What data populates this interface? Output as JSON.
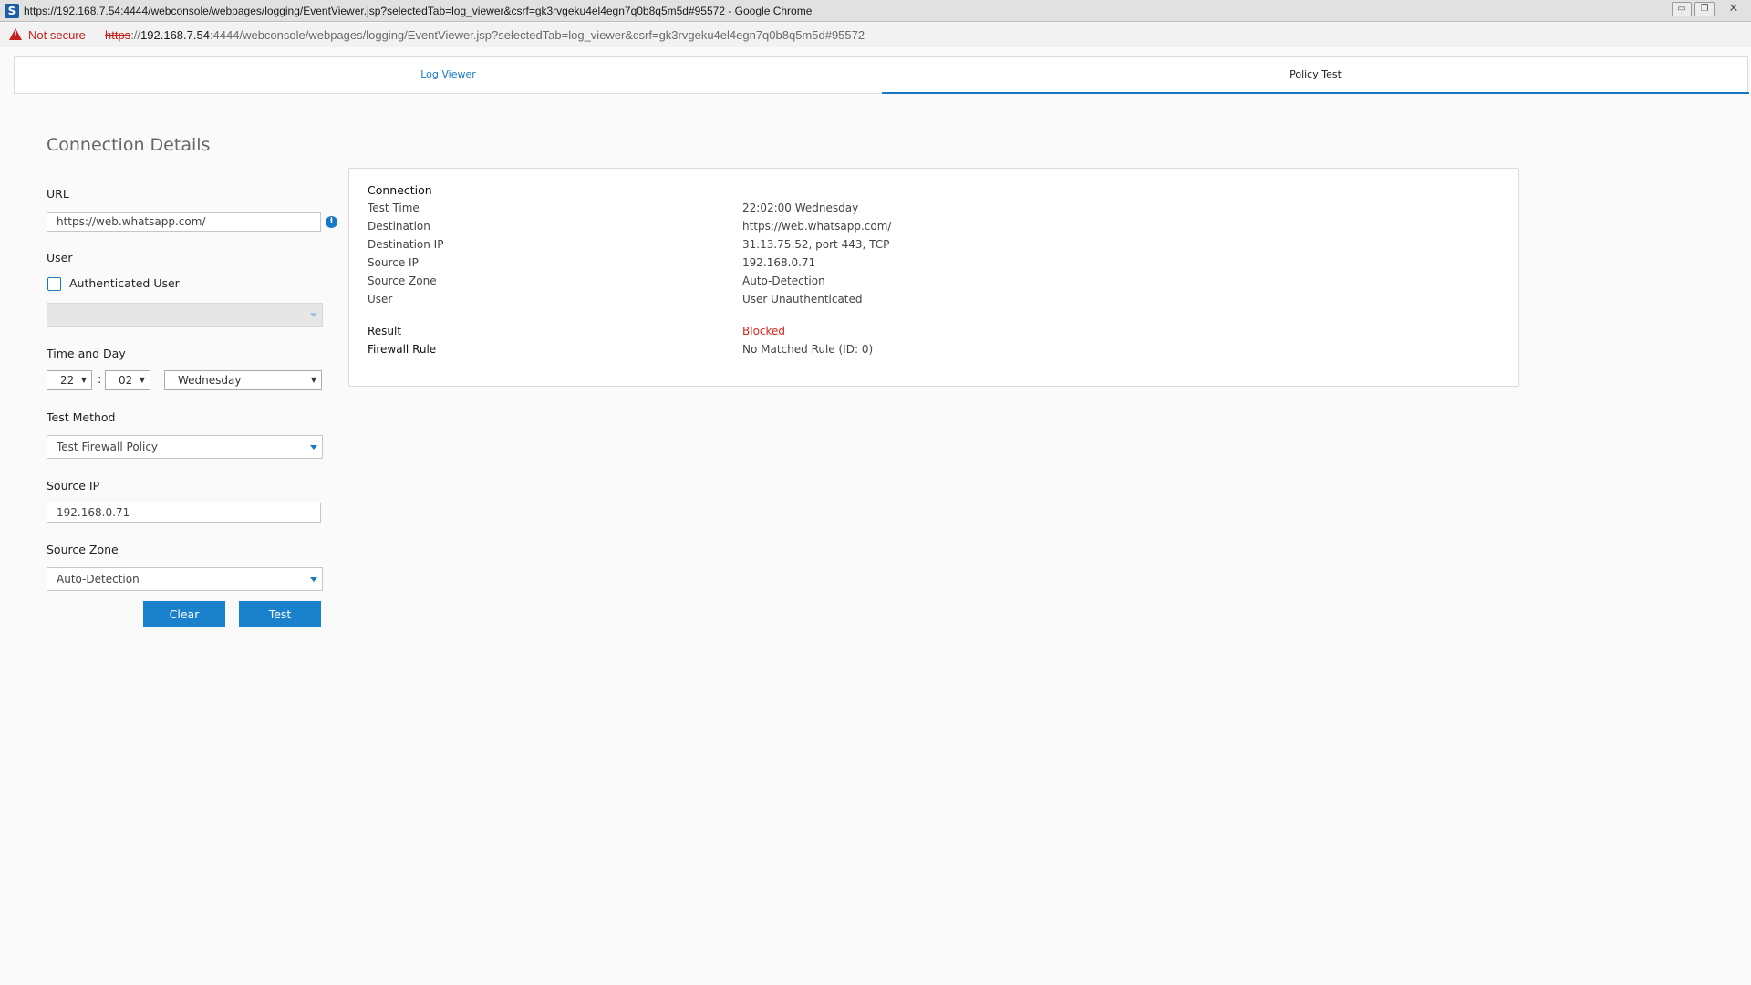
{
  "window": {
    "title": "https://192.168.7.54:4444/webconsole/webpages/logging/EventViewer.jsp?selectedTab=log_viewer&csrf=gk3rvgeku4el4egn7q0b8q5m5d#95572 - Google Chrome",
    "app_icon_letter": "S",
    "minimize": "▭",
    "maximize": "❐",
    "close": "✕"
  },
  "address_bar": {
    "security_label": "Not secure",
    "scheme": "https",
    "separator": "://",
    "host": "192.168.7.54",
    "rest": ":4444/webconsole/webpages/logging/EventViewer.jsp?selectedTab=log_viewer&csrf=gk3rvgeku4el4egn7q0b8q5m5d#95572"
  },
  "tabs": {
    "log_viewer": "Log Viewer",
    "policy_test": "Policy Test",
    "active": "Policy Test"
  },
  "form": {
    "title": "Connection Details",
    "url_label": "URL",
    "url_value": "https://web.whatsapp.com/",
    "info_icon": "i",
    "user_label": "User",
    "authenticated_user_label": "Authenticated User",
    "authenticated_user_checked": false,
    "user_select_value": "",
    "time_day_label": "Time and Day",
    "hour": "22",
    "time_separator": ":",
    "minute": "02",
    "day": "Wednesday",
    "caret_glyph": "▼",
    "test_method_label": "Test Method",
    "test_method_value": "Test Firewall Policy",
    "source_ip_label": "Source IP",
    "source_ip_value": "192.168.0.71",
    "source_zone_label": "Source Zone",
    "source_zone_value": "Auto-Detection",
    "clear_button": "Clear",
    "test_button": "Test"
  },
  "result": {
    "connection_heading": "Connection",
    "rows": [
      {
        "key": "Test Time",
        "value": "22:02:00 Wednesday"
      },
      {
        "key": "Destination",
        "value": "https://web.whatsapp.com/"
      },
      {
        "key": "Destination IP",
        "value": "31.13.75.52, port 443, TCP"
      },
      {
        "key": "Source IP",
        "value": "192.168.0.71"
      },
      {
        "key": "Source Zone",
        "value": "Auto-Detection"
      },
      {
        "key": "User",
        "value": "User Unauthenticated"
      }
    ],
    "result_label": "Result",
    "result_value": "Blocked",
    "firewall_rule_label": "Firewall Rule",
    "firewall_rule_value": "No Matched Rule (ID: 0)"
  },
  "colors": {
    "accent": "#1778c6",
    "button": "#1a82cc",
    "blocked": "#d9251c",
    "not_secure": "#c5221f"
  }
}
